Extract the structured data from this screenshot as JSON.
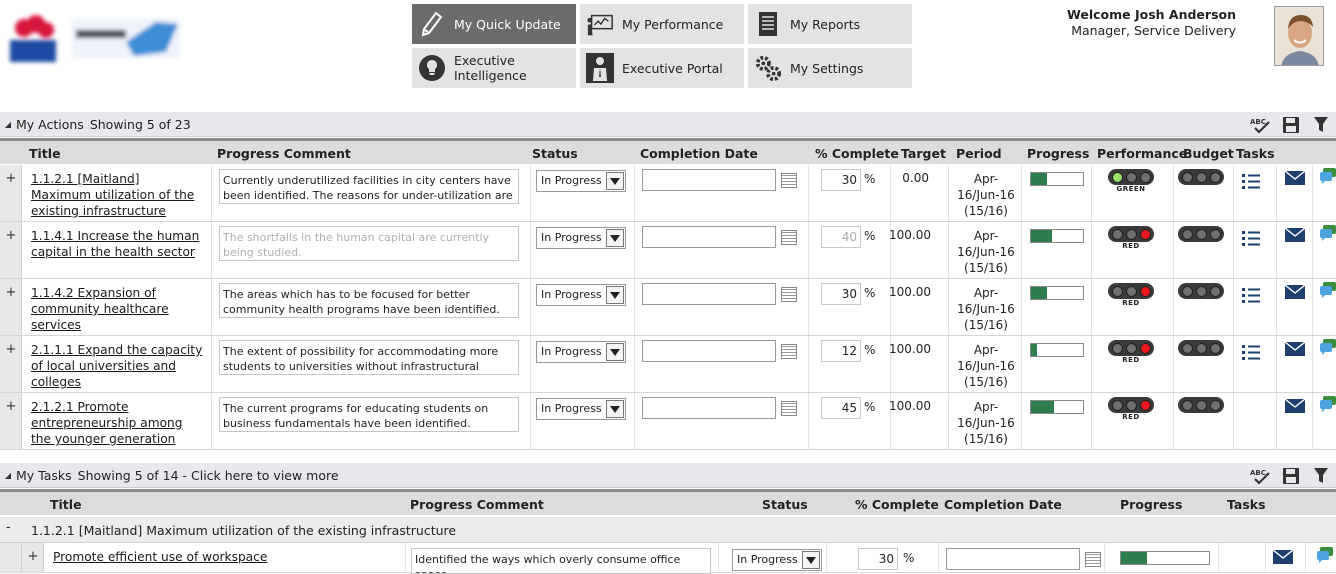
{
  "header": {
    "welcome": "Welcome Josh Anderson",
    "role": "Manager, Service Delivery"
  },
  "nav": {
    "tiles": [
      {
        "label": "My Quick Update",
        "icon": "pencil-icon",
        "active": true
      },
      {
        "label": "My Performance",
        "icon": "presentation-chart-icon",
        "active": false
      },
      {
        "label": "My Reports",
        "icon": "report-document-icon",
        "active": false
      },
      {
        "label": "Executive Intelligence",
        "icon": "lightbulb-icon",
        "active": false
      },
      {
        "label": "Executive Portal",
        "icon": "businessman-icon",
        "active": false
      },
      {
        "label": "My Settings",
        "icon": "gears-icon",
        "active": false
      }
    ]
  },
  "actions": {
    "title": "My Actions",
    "showing": "Showing 5 of 23",
    "columns": {
      "title": "Title",
      "comment": "Progress Comment",
      "status": "Status",
      "completion": "Completion Date",
      "pct": "% Complete",
      "target": "Target",
      "period": "Period",
      "progress": "Progress",
      "performance": "Performance",
      "budget": "Budget",
      "tasks": "Tasks"
    },
    "rows": [
      {
        "title": "1.1.2.1 [Maitland] Maximum utilization of the existing infrastructure",
        "comment": "Currently underutilized facilities in city centers have been identified. The reasons for under-utilization  are being",
        "comment_dim": false,
        "status": "In Progress",
        "completion": "",
        "pct": "30",
        "pct_dim": false,
        "target": "0.00",
        "period": [
          "Apr-",
          "16/Jun-16",
          "(15/16)"
        ],
        "progress": 0.3,
        "performance": "GREEN",
        "has_tasks": true
      },
      {
        "title": "1.1.4.1 Increase the human capital in the health sector",
        "comment": "The shortfalls in the human capital are currently being studied.",
        "comment_dim": true,
        "status": "In Progress",
        "completion": "",
        "pct": "40",
        "pct_dim": true,
        "target": "100.00",
        "period": [
          "Apr-",
          "16/Jun-16",
          "(15/16)"
        ],
        "progress": 0.4,
        "performance": "RED",
        "has_tasks": true
      },
      {
        "title": "1.1.4.2 Expansion of community healthcare services",
        "comment": "The areas which has to be focused for better community health programs have been identified.",
        "comment_dim": false,
        "status": "In Progress",
        "completion": "",
        "pct": "30",
        "pct_dim": false,
        "target": "100.00",
        "period": [
          "Apr-",
          "16/Jun-16",
          "(15/16)"
        ],
        "progress": 0.3,
        "performance": "RED",
        "has_tasks": true
      },
      {
        "title": "2.1.1.1 Expand the capacity of local universities and colleges",
        "comment": "The extent of possibility for accommodating more students to universities without infrastructural expansions are",
        "comment_dim": false,
        "status": "In Progress",
        "completion": "",
        "pct": "12",
        "pct_dim": false,
        "target": "100.00",
        "period": [
          "Apr-",
          "16/Jun-16",
          "(15/16)"
        ],
        "progress": 0.12,
        "performance": "RED",
        "has_tasks": true
      },
      {
        "title": "2.1.2.1 Promote entrepreneurship among the younger generation",
        "comment": "The current programs for educating students on business fundamentals have been identified.",
        "comment_dim": false,
        "status": "In Progress",
        "completion": "",
        "pct": "45",
        "pct_dim": false,
        "target": "100.00",
        "period": [
          "Apr-",
          "16/Jun-16",
          "(15/16)"
        ],
        "progress": 0.45,
        "performance": "RED",
        "has_tasks": false
      }
    ]
  },
  "tasks": {
    "title": "My Tasks",
    "showing": "Showing 5 of 14 - Click here to view more",
    "columns": {
      "title": "Title",
      "comment": "Progress Comment",
      "status": "Status",
      "pct": "% Complete",
      "completion": "Completion Date",
      "progress": "Progress",
      "tasks": "Tasks"
    },
    "group": {
      "expander": "-",
      "label": "1.1.2.1 [Maitland] Maximum utilization of the existing infrastructure"
    },
    "rows": [
      {
        "title": "Promote efficient use of workspace",
        "comment": "Identified the ways which overly consume office space.",
        "status": "In Progress",
        "pct": "30",
        "completion": "",
        "progress": 0.3
      }
    ]
  },
  "symbols": {
    "plus": "+",
    "percent": "%"
  },
  "colors": {
    "active_tile": "#6b6b6b",
    "progress_fill": "#2e7d4f",
    "red_light": "#e8181c",
    "green_light": "#9be36b"
  }
}
